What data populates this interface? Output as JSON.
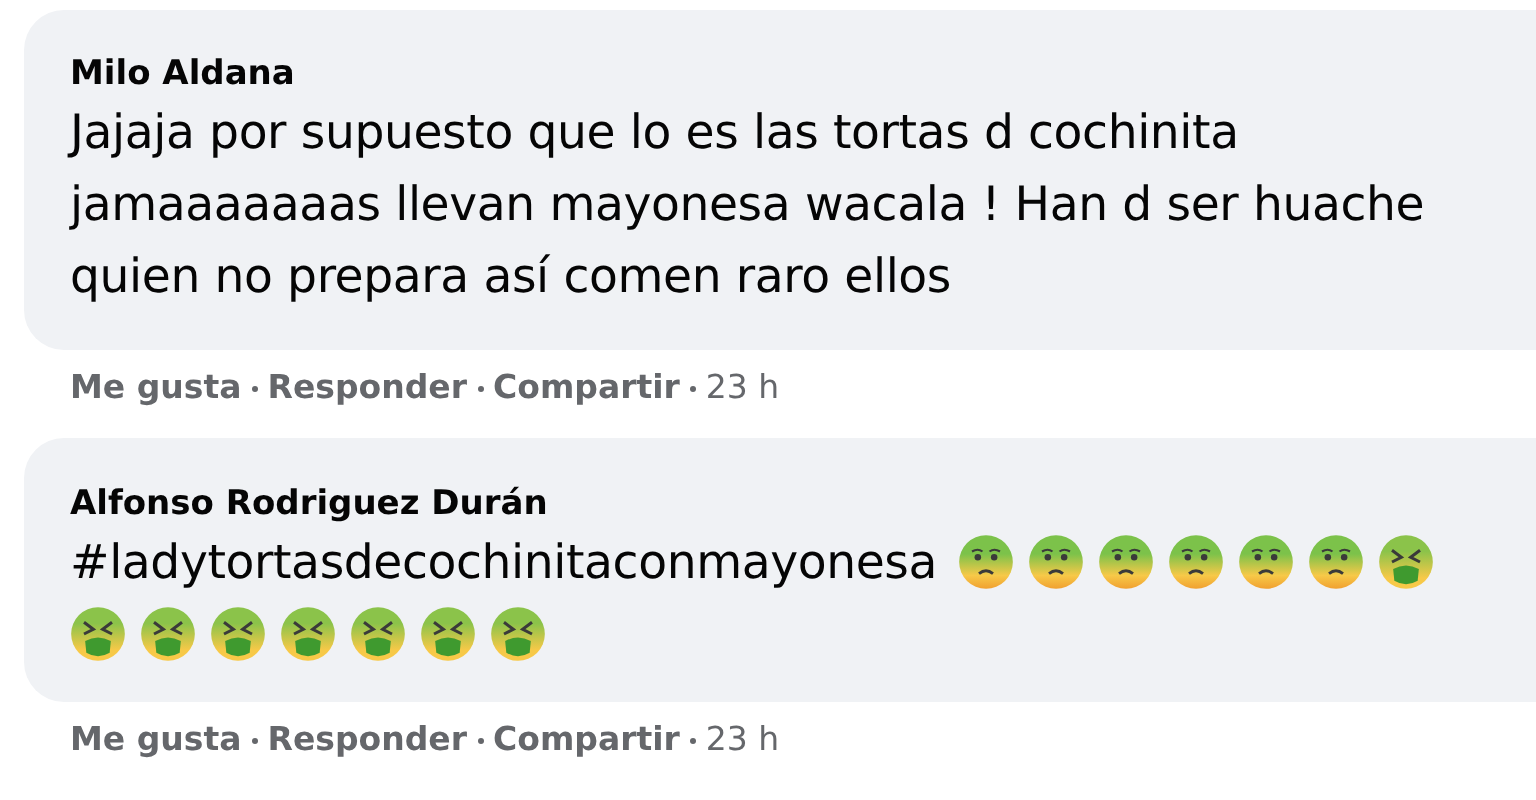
{
  "comments": [
    {
      "author": "Milo Aldana",
      "lines": [
        {
          "text": "Jajaja por supuesto que lo es las tortas d cochinita"
        },
        {
          "text": "jamaaaaaaas llevan mayonesa wacala ! Han d ser huache"
        },
        {
          "text": "quien no prepara así comen raro ellos"
        }
      ],
      "actions": [
        "Me gusta",
        "Responder",
        "Compartir"
      ],
      "time": "23 h"
    },
    {
      "author": "Alfonso Rodriguez Durán",
      "lines": [
        {
          "text": "#ladytortasdecochinitaconmayonesa",
          "emojis": [
            {
              "kind": "nauseated"
            },
            {
              "kind": "nauseated"
            },
            {
              "kind": "nauseated"
            },
            {
              "kind": "nauseated"
            },
            {
              "kind": "nauseated"
            },
            {
              "kind": "nauseated"
            },
            {
              "kind": "vomiting"
            }
          ]
        },
        {
          "emojis": [
            {
              "kind": "vomiting"
            },
            {
              "kind": "vomiting"
            },
            {
              "kind": "vomiting"
            },
            {
              "kind": "vomiting"
            },
            {
              "kind": "vomiting"
            },
            {
              "kind": "vomiting"
            },
            {
              "kind": "vomiting"
            }
          ]
        }
      ],
      "actions": [
        "Me gusta",
        "Responder",
        "Compartir"
      ],
      "time": "23 h"
    }
  ]
}
